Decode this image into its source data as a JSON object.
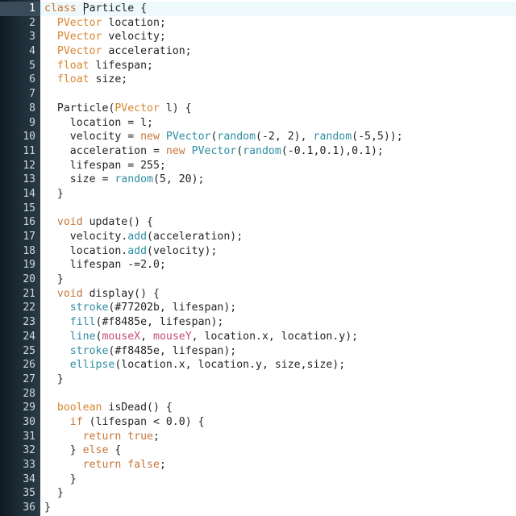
{
  "editor": {
    "current_line": 1,
    "line_numbers": [
      "1",
      "2",
      "3",
      "4",
      "5",
      "6",
      "7",
      "8",
      "9",
      "10",
      "11",
      "12",
      "13",
      "14",
      "15",
      "16",
      "17",
      "18",
      "19",
      "20",
      "21",
      "22",
      "23",
      "24",
      "25",
      "26",
      "27",
      "28",
      "29",
      "30",
      "31",
      "32",
      "33",
      "34",
      "35",
      "36"
    ],
    "lines": [
      [
        [
          "keyword",
          "class"
        ],
        [
          "plain",
          " Particle {"
        ]
      ],
      [
        [
          "plain",
          "  "
        ],
        [
          "type",
          "PVector"
        ],
        [
          "plain",
          " location;"
        ]
      ],
      [
        [
          "plain",
          "  "
        ],
        [
          "type",
          "PVector"
        ],
        [
          "plain",
          " velocity;"
        ]
      ],
      [
        [
          "plain",
          "  "
        ],
        [
          "type",
          "PVector"
        ],
        [
          "plain",
          " acceleration;"
        ]
      ],
      [
        [
          "plain",
          "  "
        ],
        [
          "type",
          "float"
        ],
        [
          "plain",
          " lifespan;"
        ]
      ],
      [
        [
          "plain",
          "  "
        ],
        [
          "type",
          "float"
        ],
        [
          "plain",
          " size;"
        ]
      ],
      [
        [
          "plain",
          ""
        ]
      ],
      [
        [
          "plain",
          "  Particle("
        ],
        [
          "type",
          "PVector"
        ],
        [
          "plain",
          " l) {"
        ]
      ],
      [
        [
          "plain",
          "    location = l;"
        ]
      ],
      [
        [
          "plain",
          "    velocity = "
        ],
        [
          "keyword",
          "new"
        ],
        [
          "plain",
          " "
        ],
        [
          "builtin",
          "PVector"
        ],
        [
          "plain",
          "("
        ],
        [
          "builtin",
          "random"
        ],
        [
          "plain",
          "(-2, 2), "
        ],
        [
          "builtin",
          "random"
        ],
        [
          "plain",
          "(-5,5));"
        ]
      ],
      [
        [
          "plain",
          "    acceleration = "
        ],
        [
          "keyword",
          "new"
        ],
        [
          "plain",
          " "
        ],
        [
          "builtin",
          "PVector"
        ],
        [
          "plain",
          "("
        ],
        [
          "builtin",
          "random"
        ],
        [
          "plain",
          "(-0.1,0.1),0.1);"
        ]
      ],
      [
        [
          "plain",
          "    lifespan = 255;"
        ]
      ],
      [
        [
          "plain",
          "    size = "
        ],
        [
          "builtin",
          "random"
        ],
        [
          "plain",
          "(5, 20);"
        ]
      ],
      [
        [
          "plain",
          "  }"
        ]
      ],
      [
        [
          "plain",
          ""
        ]
      ],
      [
        [
          "plain",
          "  "
        ],
        [
          "keyword",
          "void"
        ],
        [
          "plain",
          " update() {"
        ]
      ],
      [
        [
          "plain",
          "    velocity."
        ],
        [
          "builtin",
          "add"
        ],
        [
          "plain",
          "(acceleration);"
        ]
      ],
      [
        [
          "plain",
          "    location."
        ],
        [
          "builtin",
          "add"
        ],
        [
          "plain",
          "(velocity);"
        ]
      ],
      [
        [
          "plain",
          "    lifespan -=2.0;"
        ]
      ],
      [
        [
          "plain",
          "  }"
        ]
      ],
      [
        [
          "plain",
          "  "
        ],
        [
          "keyword",
          "void"
        ],
        [
          "plain",
          " display() {"
        ]
      ],
      [
        [
          "plain",
          "    "
        ],
        [
          "builtin",
          "stroke"
        ],
        [
          "plain",
          "(#77202b, lifespan);"
        ]
      ],
      [
        [
          "plain",
          "    "
        ],
        [
          "builtin",
          "fill"
        ],
        [
          "plain",
          "(#f8485e, lifespan);"
        ]
      ],
      [
        [
          "plain",
          "    "
        ],
        [
          "builtin",
          "line"
        ],
        [
          "plain",
          "("
        ],
        [
          "call",
          "mouseX"
        ],
        [
          "plain",
          ", "
        ],
        [
          "call",
          "mouseY"
        ],
        [
          "plain",
          ", location.x, location.y);"
        ]
      ],
      [
        [
          "plain",
          "    "
        ],
        [
          "builtin",
          "stroke"
        ],
        [
          "plain",
          "(#f8485e, lifespan);"
        ]
      ],
      [
        [
          "plain",
          "    "
        ],
        [
          "builtin",
          "ellipse"
        ],
        [
          "plain",
          "(location.x, location.y, size,size);"
        ]
      ],
      [
        [
          "plain",
          "  }"
        ]
      ],
      [
        [
          "plain",
          ""
        ]
      ],
      [
        [
          "plain",
          "  "
        ],
        [
          "type",
          "boolean"
        ],
        [
          "plain",
          " isDead() {"
        ]
      ],
      [
        [
          "plain",
          "    "
        ],
        [
          "keyword",
          "if"
        ],
        [
          "plain",
          " (lifespan < 0.0) {"
        ]
      ],
      [
        [
          "plain",
          "      "
        ],
        [
          "keyword",
          "return"
        ],
        [
          "plain",
          " "
        ],
        [
          "keyword",
          "true"
        ],
        [
          "plain",
          ";"
        ]
      ],
      [
        [
          "plain",
          "    } "
        ],
        [
          "keyword",
          "else"
        ],
        [
          "plain",
          " {"
        ]
      ],
      [
        [
          "plain",
          "      "
        ],
        [
          "keyword",
          "return"
        ],
        [
          "plain",
          " "
        ],
        [
          "keyword",
          "false"
        ],
        [
          "plain",
          ";"
        ]
      ],
      [
        [
          "plain",
          "    }"
        ]
      ],
      [
        [
          "plain",
          "  }"
        ]
      ],
      [
        [
          "plain",
          "}"
        ]
      ]
    ]
  }
}
